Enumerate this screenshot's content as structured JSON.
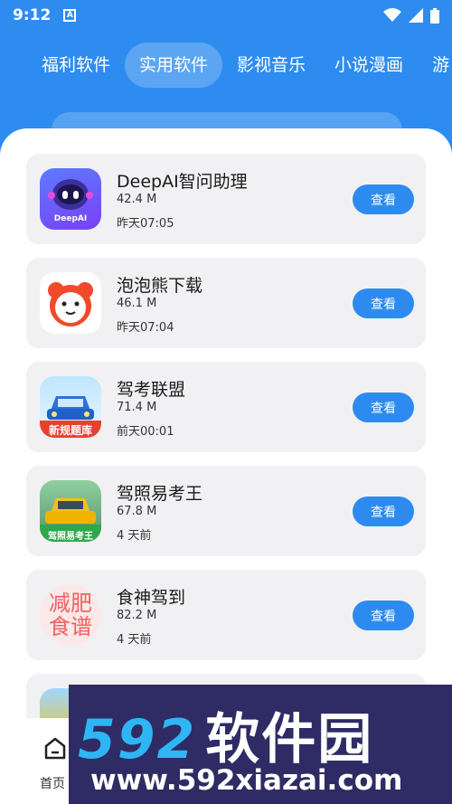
{
  "status": {
    "time": "9:12",
    "notif": "A"
  },
  "tabs": [
    {
      "label": "福利软件"
    },
    {
      "label": "实用软件"
    },
    {
      "label": "影视音乐"
    },
    {
      "label": "小说漫画"
    },
    {
      "label": "游"
    }
  ],
  "apps": [
    {
      "name": "DeepAI智问助理",
      "size": "42.4 M",
      "date": "昨天07:05",
      "icon": "deepai-robot-icon",
      "icon_text": "DeepAI",
      "button": "查看"
    },
    {
      "name": "泡泡熊下载",
      "size": "46.1 M",
      "date": "昨天07:04",
      "icon": "bear-icon",
      "button": "查看"
    },
    {
      "name": "驾考联盟",
      "size": "71.4 M",
      "date": "前天00:01",
      "icon": "car-icon",
      "icon_text": "新规题库",
      "button": "查看"
    },
    {
      "name": "驾照易考王",
      "size": "67.8 M",
      "date": "4 天前",
      "icon": "taxi-icon",
      "icon_text": "驾照易考王",
      "button": "查看"
    },
    {
      "name": "食神驾到",
      "size": "82.2 M",
      "date": "4 天前",
      "icon": "diet-recipe-icon",
      "icon_text": "减肥食谱",
      "button": "查看"
    }
  ],
  "nav": {
    "home_label": "首页"
  },
  "watermark": {
    "brand": "592",
    "brand_cn": "软件园",
    "url": "www.592xiazai.com"
  },
  "colors": {
    "primary": "#2e8cf0",
    "card": "#f1f1f3",
    "button": "#2d8bef"
  }
}
